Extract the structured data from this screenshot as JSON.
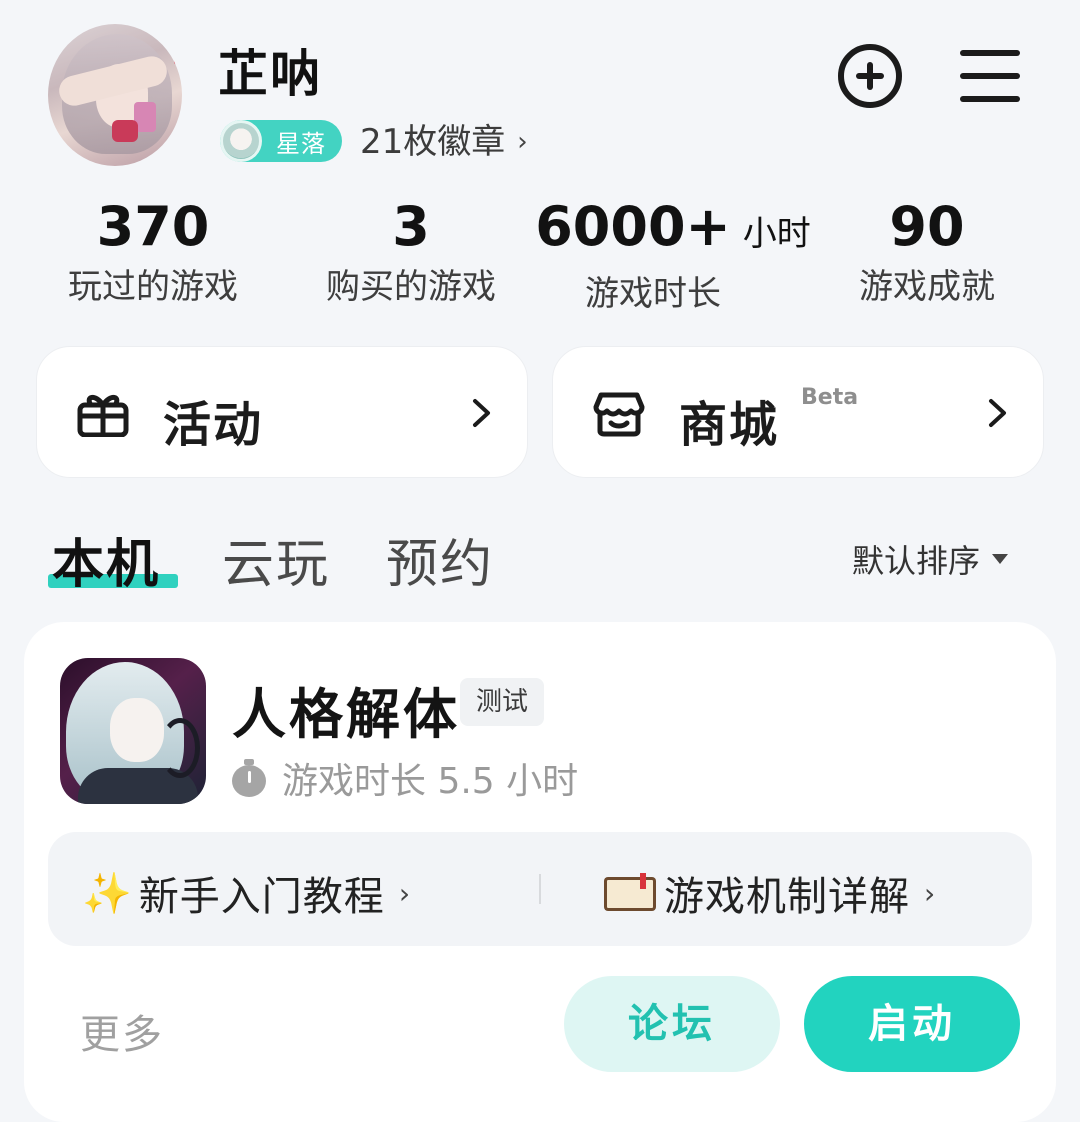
{
  "profile": {
    "username": "芷呐",
    "level_label": "星落",
    "badges_text": "21枚徽章",
    "badges_chevron": "›"
  },
  "header_icons": {
    "add": "add-circle-icon",
    "menu": "hamburger-menu-icon"
  },
  "stats": [
    {
      "value": "370",
      "unit": "",
      "label": "玩过的游戏"
    },
    {
      "value": "3",
      "unit": "",
      "label": "购买的游戏"
    },
    {
      "value": "6000+",
      "unit": "小时",
      "label": "游戏时长"
    },
    {
      "value": "90",
      "unit": "",
      "label": "游戏成就"
    }
  ],
  "features": {
    "events": {
      "label": "活动",
      "icon": "gift-icon"
    },
    "store": {
      "label": "商城",
      "badge": "Beta",
      "icon": "store-icon"
    }
  },
  "tabs": {
    "local": "本机",
    "cloud": "云玩",
    "reserve": "预约",
    "active": "local"
  },
  "sort": {
    "label": "默认排序"
  },
  "game": {
    "title": "人格解体",
    "tag": "测试",
    "playtime": "游戏时长 5.5 小时",
    "guides": [
      {
        "emoji": "✨",
        "label": "新手入门教程",
        "chevron": "›"
      },
      {
        "emoji": "📖",
        "label": "游戏机制详解",
        "chevron": "›"
      }
    ],
    "more_label": "更多",
    "forum_label": "论坛",
    "launch_label": "启动"
  },
  "colors": {
    "accent": "#22d3bf",
    "accent_light": "#def6f3",
    "background": "#f4f6f9"
  }
}
